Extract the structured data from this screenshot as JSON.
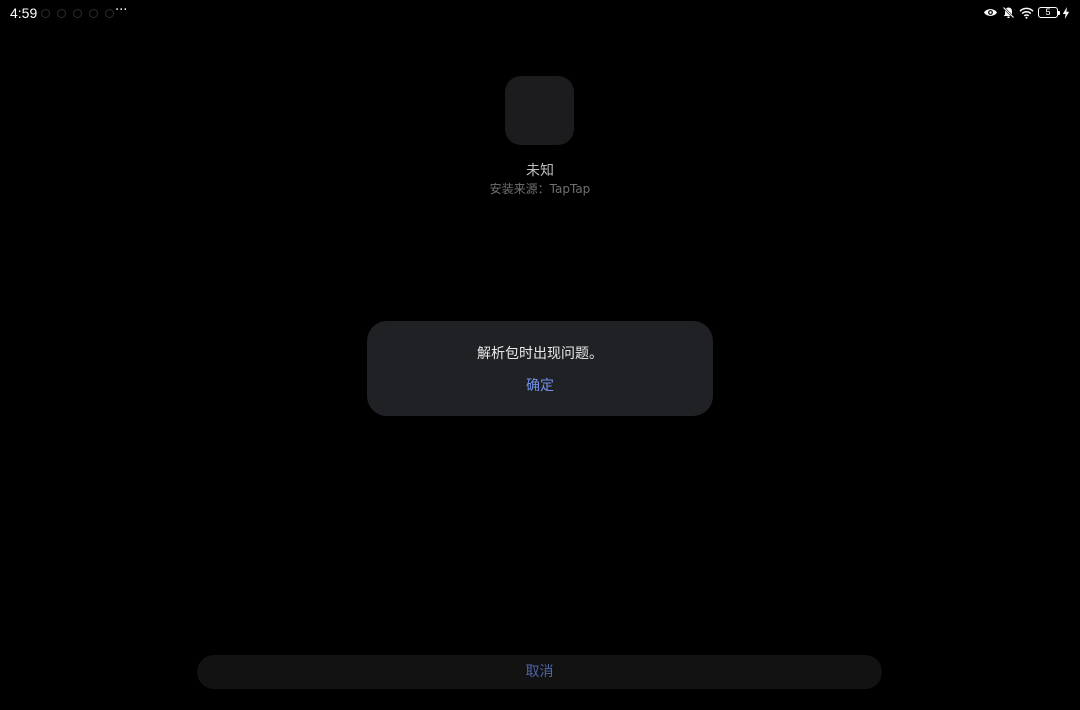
{
  "status_bar": {
    "time": "4:59",
    "more": "···",
    "battery_level": "5",
    "icons": [
      "eye-icon",
      "bell-off-icon",
      "wifi-icon",
      "battery-icon",
      "charging-icon"
    ]
  },
  "app": {
    "name": "未知",
    "source": "安装来源：TapTap"
  },
  "dialog": {
    "message": "解析包时出现问题。",
    "confirm_label": "确定"
  },
  "footer": {
    "cancel_label": "取消"
  },
  "colors": {
    "background": "#000000",
    "dialog_bg": "#202124",
    "accent": "#6f8fe8",
    "cancel_text": "#4e64a8"
  }
}
